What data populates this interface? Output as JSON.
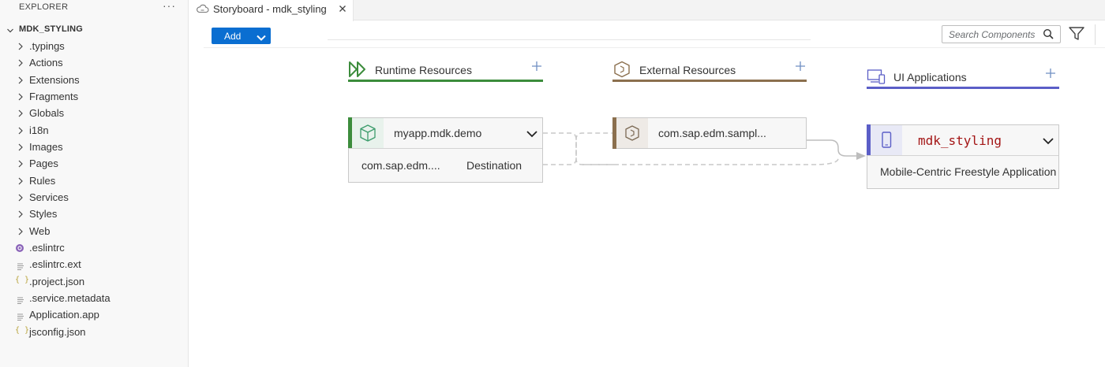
{
  "explorer": {
    "title": "EXPLORER",
    "more": "···",
    "root_label": "MDK_STYLING",
    "folders": [
      {
        "label": ".typings"
      },
      {
        "label": "Actions"
      },
      {
        "label": "Extensions"
      },
      {
        "label": "Fragments"
      },
      {
        "label": "Globals"
      },
      {
        "label": "i18n"
      },
      {
        "label": "Images"
      },
      {
        "label": "Pages"
      },
      {
        "label": "Rules"
      },
      {
        "label": "Services"
      },
      {
        "label": "Styles"
      },
      {
        "label": "Web"
      }
    ],
    "files": [
      {
        "label": ".eslintrc",
        "icon": "eslint-icon"
      },
      {
        "label": ".eslintrc.ext",
        "icon": "file-lines-icon"
      },
      {
        "label": ".project.json",
        "icon": "json-braces-icon"
      },
      {
        "label": ".service.metadata",
        "icon": "file-lines-icon"
      },
      {
        "label": "Application.app",
        "icon": "file-lines-icon"
      },
      {
        "label": "jsconfig.json",
        "icon": "json-braces-icon"
      }
    ]
  },
  "tab": {
    "label": "Storyboard - mdk_styling",
    "icon": "cloud-icon"
  },
  "toolbar": {
    "add_label": "Add",
    "search_placeholder": "Search Components"
  },
  "columns": {
    "runtime": {
      "title": "Runtime Resources",
      "color": "#3c8c3c"
    },
    "external": {
      "title": "External Resources",
      "color": "#8b6f4e"
    },
    "ui": {
      "title": "UI Applications",
      "color": "#5b5ec7"
    }
  },
  "cards": {
    "runtime": {
      "title": "myapp.mdk.demo",
      "sub_left": "com.sap.edm....",
      "sub_right": "Destination"
    },
    "external": {
      "title": "com.sap.edm.sampl..."
    },
    "ui": {
      "title": "mdk_styling",
      "sub": "Mobile-Centric Freestyle Application"
    }
  },
  "colors": {
    "accent_blue": "#0a6ed1",
    "runtime_green": "#3c8c3c",
    "external_brown": "#8b6f4e",
    "ui_purple": "#5b5ec7",
    "ui_title_red": "#a31515"
  }
}
